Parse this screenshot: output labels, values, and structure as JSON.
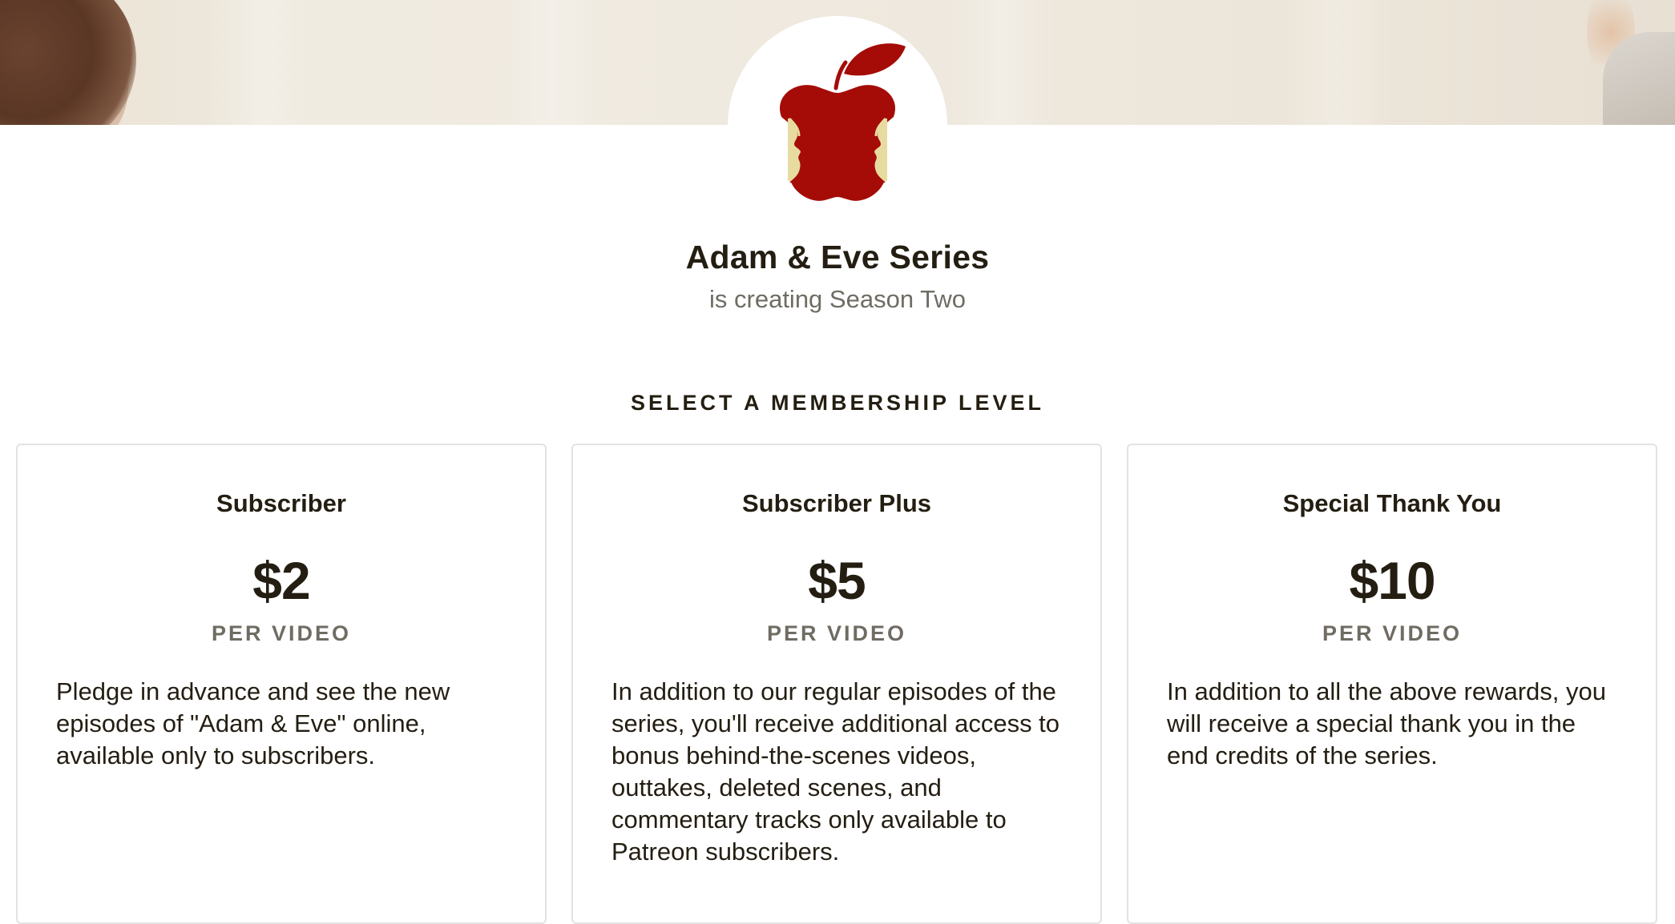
{
  "creator": {
    "name": "Adam & Eve Series",
    "tagline": "is creating Season Two"
  },
  "membership": {
    "heading": "SELECT A MEMBERSHIP LEVEL",
    "tiers": [
      {
        "title": "Subscriber",
        "price": "$2",
        "period": "PER VIDEO",
        "description": "Pledge in advance and see the new episodes of \"Adam & Eve\" online, available only to subscribers."
      },
      {
        "title": "Subscriber Plus",
        "price": "$5",
        "period": "PER VIDEO",
        "description": "In addition to our regular episodes of the series, you'll receive additional access to bonus behind-the-scenes videos, outtakes, deleted scenes, and commentary tracks only available to Patreon subscribers."
      },
      {
        "title": "Special Thank You",
        "price": "$10",
        "period": "PER VIDEO",
        "description": "In addition to all the above rewards, you will receive a special thank you in the end credits of the series."
      }
    ]
  },
  "colors": {
    "apple_red": "#a50c07",
    "apple_core": "#e8dba0",
    "text_dark": "#241e12",
    "text_muted": "#706c63",
    "card_border": "#e3e3e3"
  },
  "icons": {
    "avatar": "bitten-apple-faces-logo"
  }
}
